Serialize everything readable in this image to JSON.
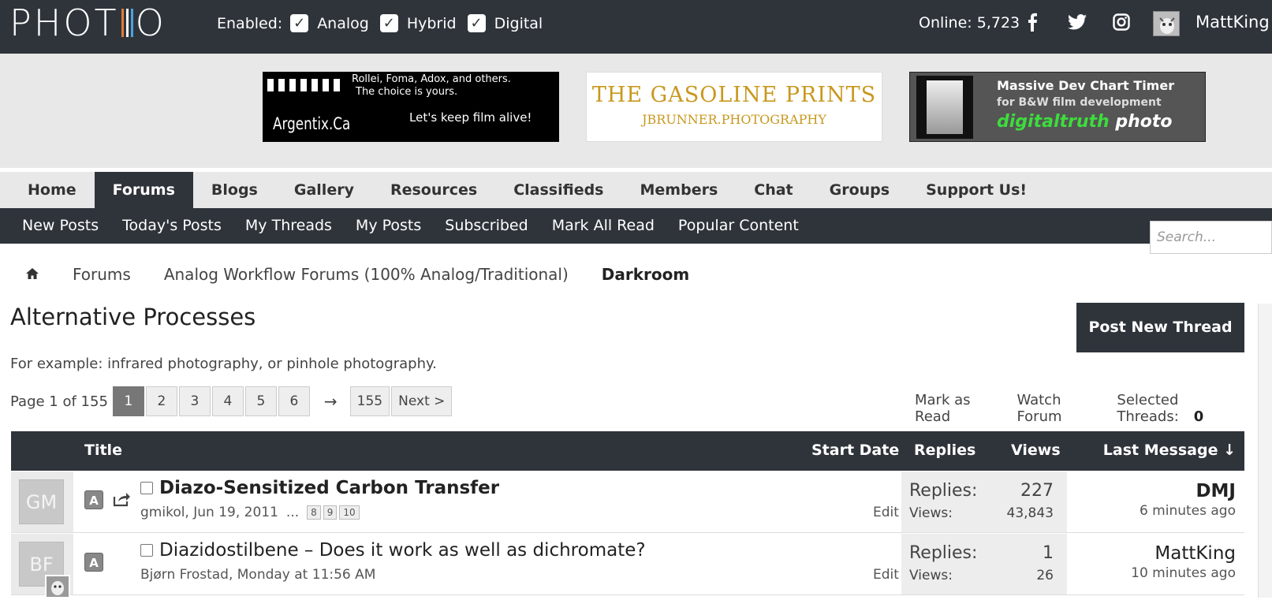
{
  "brand": {
    "logo_left": "PHOT",
    "logo_right": "O",
    "bar_colors": [
      "#e07b39",
      "#ffffff",
      "#4aa3df"
    ]
  },
  "topbar": {
    "enabled_label": "Enabled:",
    "filters": [
      {
        "label": "Analog",
        "checked": true
      },
      {
        "label": "Hybrid",
        "checked": true
      },
      {
        "label": "Digital",
        "checked": true
      }
    ],
    "online": "Online: 5,723",
    "social": [
      "facebook-icon",
      "twitter-icon",
      "instagram-icon"
    ],
    "username": "MattKing"
  },
  "ads": {
    "ad1": {
      "line1": "Rollei, Foma, Adox, and others.",
      "line2": "The choice is yours.",
      "brand": "Argentix.Ca",
      "tagline": "Let's keep film alive!"
    },
    "ad2": {
      "title": "THE GASOLINE PRINTS",
      "subtitle": "JBRUNNER.PHOTOGRAPHY"
    },
    "ad3": {
      "title": "Massive Dev Chart Timer",
      "subtitle": "for B&W film development",
      "brand1": "digitaltruth",
      "brand2": "photo"
    }
  },
  "mainnav": [
    "Home",
    "Forums",
    "Blogs",
    "Gallery",
    "Resources",
    "Classifieds",
    "Members",
    "Chat",
    "Groups",
    "Support Us!"
  ],
  "mainnav_active": "Forums",
  "subnav": [
    "New Posts",
    "Today's Posts",
    "My Threads",
    "My Posts",
    "Subscribed",
    "Mark All Read",
    "Popular Content"
  ],
  "search": {
    "placeholder": "Search..."
  },
  "breadcrumb": {
    "c1": "Forums",
    "c2": "Analog Workflow Forums (100% Analog/Traditional)",
    "c3": "Darkroom"
  },
  "forum": {
    "title": "Alternative Processes",
    "description": "For example: infrared photography, or pinhole photography.",
    "post_button": "Post New Thread"
  },
  "pager": {
    "label": "Page 1 of 155",
    "pages": [
      "1",
      "2",
      "3",
      "4",
      "5",
      "6"
    ],
    "arrow": "→",
    "last": "155",
    "next": "Next >"
  },
  "actions": {
    "mark_read": "Mark as Read",
    "watch": "Watch Forum",
    "selected_label": "Selected Threads:",
    "selected_count": "0"
  },
  "table": {
    "headers": {
      "title": "Title",
      "start_date": "Start Date",
      "replies": "Replies",
      "views": "Views",
      "last": "Last Message ↓"
    },
    "rows": [
      {
        "avatar": "GM",
        "badge": "A",
        "title": "Diazo-Sensitized Carbon Transfer",
        "unread": true,
        "author_date": "gmikol, Jun 19, 2011",
        "dots": "...",
        "pages": [
          "8",
          "9",
          "10"
        ],
        "edit": "Edit",
        "replies_label": "Replies:",
        "replies": "227",
        "views_label": "Views:",
        "views": "43,843",
        "last_user": "DMJ",
        "last_time": "6 minutes ago"
      },
      {
        "avatar": "BF",
        "badge": "A",
        "title": "Diazidostilbene – Does it work as well as dichromate?",
        "unread": false,
        "author_date": "Bjørn Frostad, Monday at 11:56 AM",
        "edit": "Edit",
        "replies_label": "Replies:",
        "replies": "1",
        "views_label": "Views:",
        "views": "26",
        "last_user": "MattKing",
        "last_time": "10 minutes ago"
      }
    ]
  }
}
